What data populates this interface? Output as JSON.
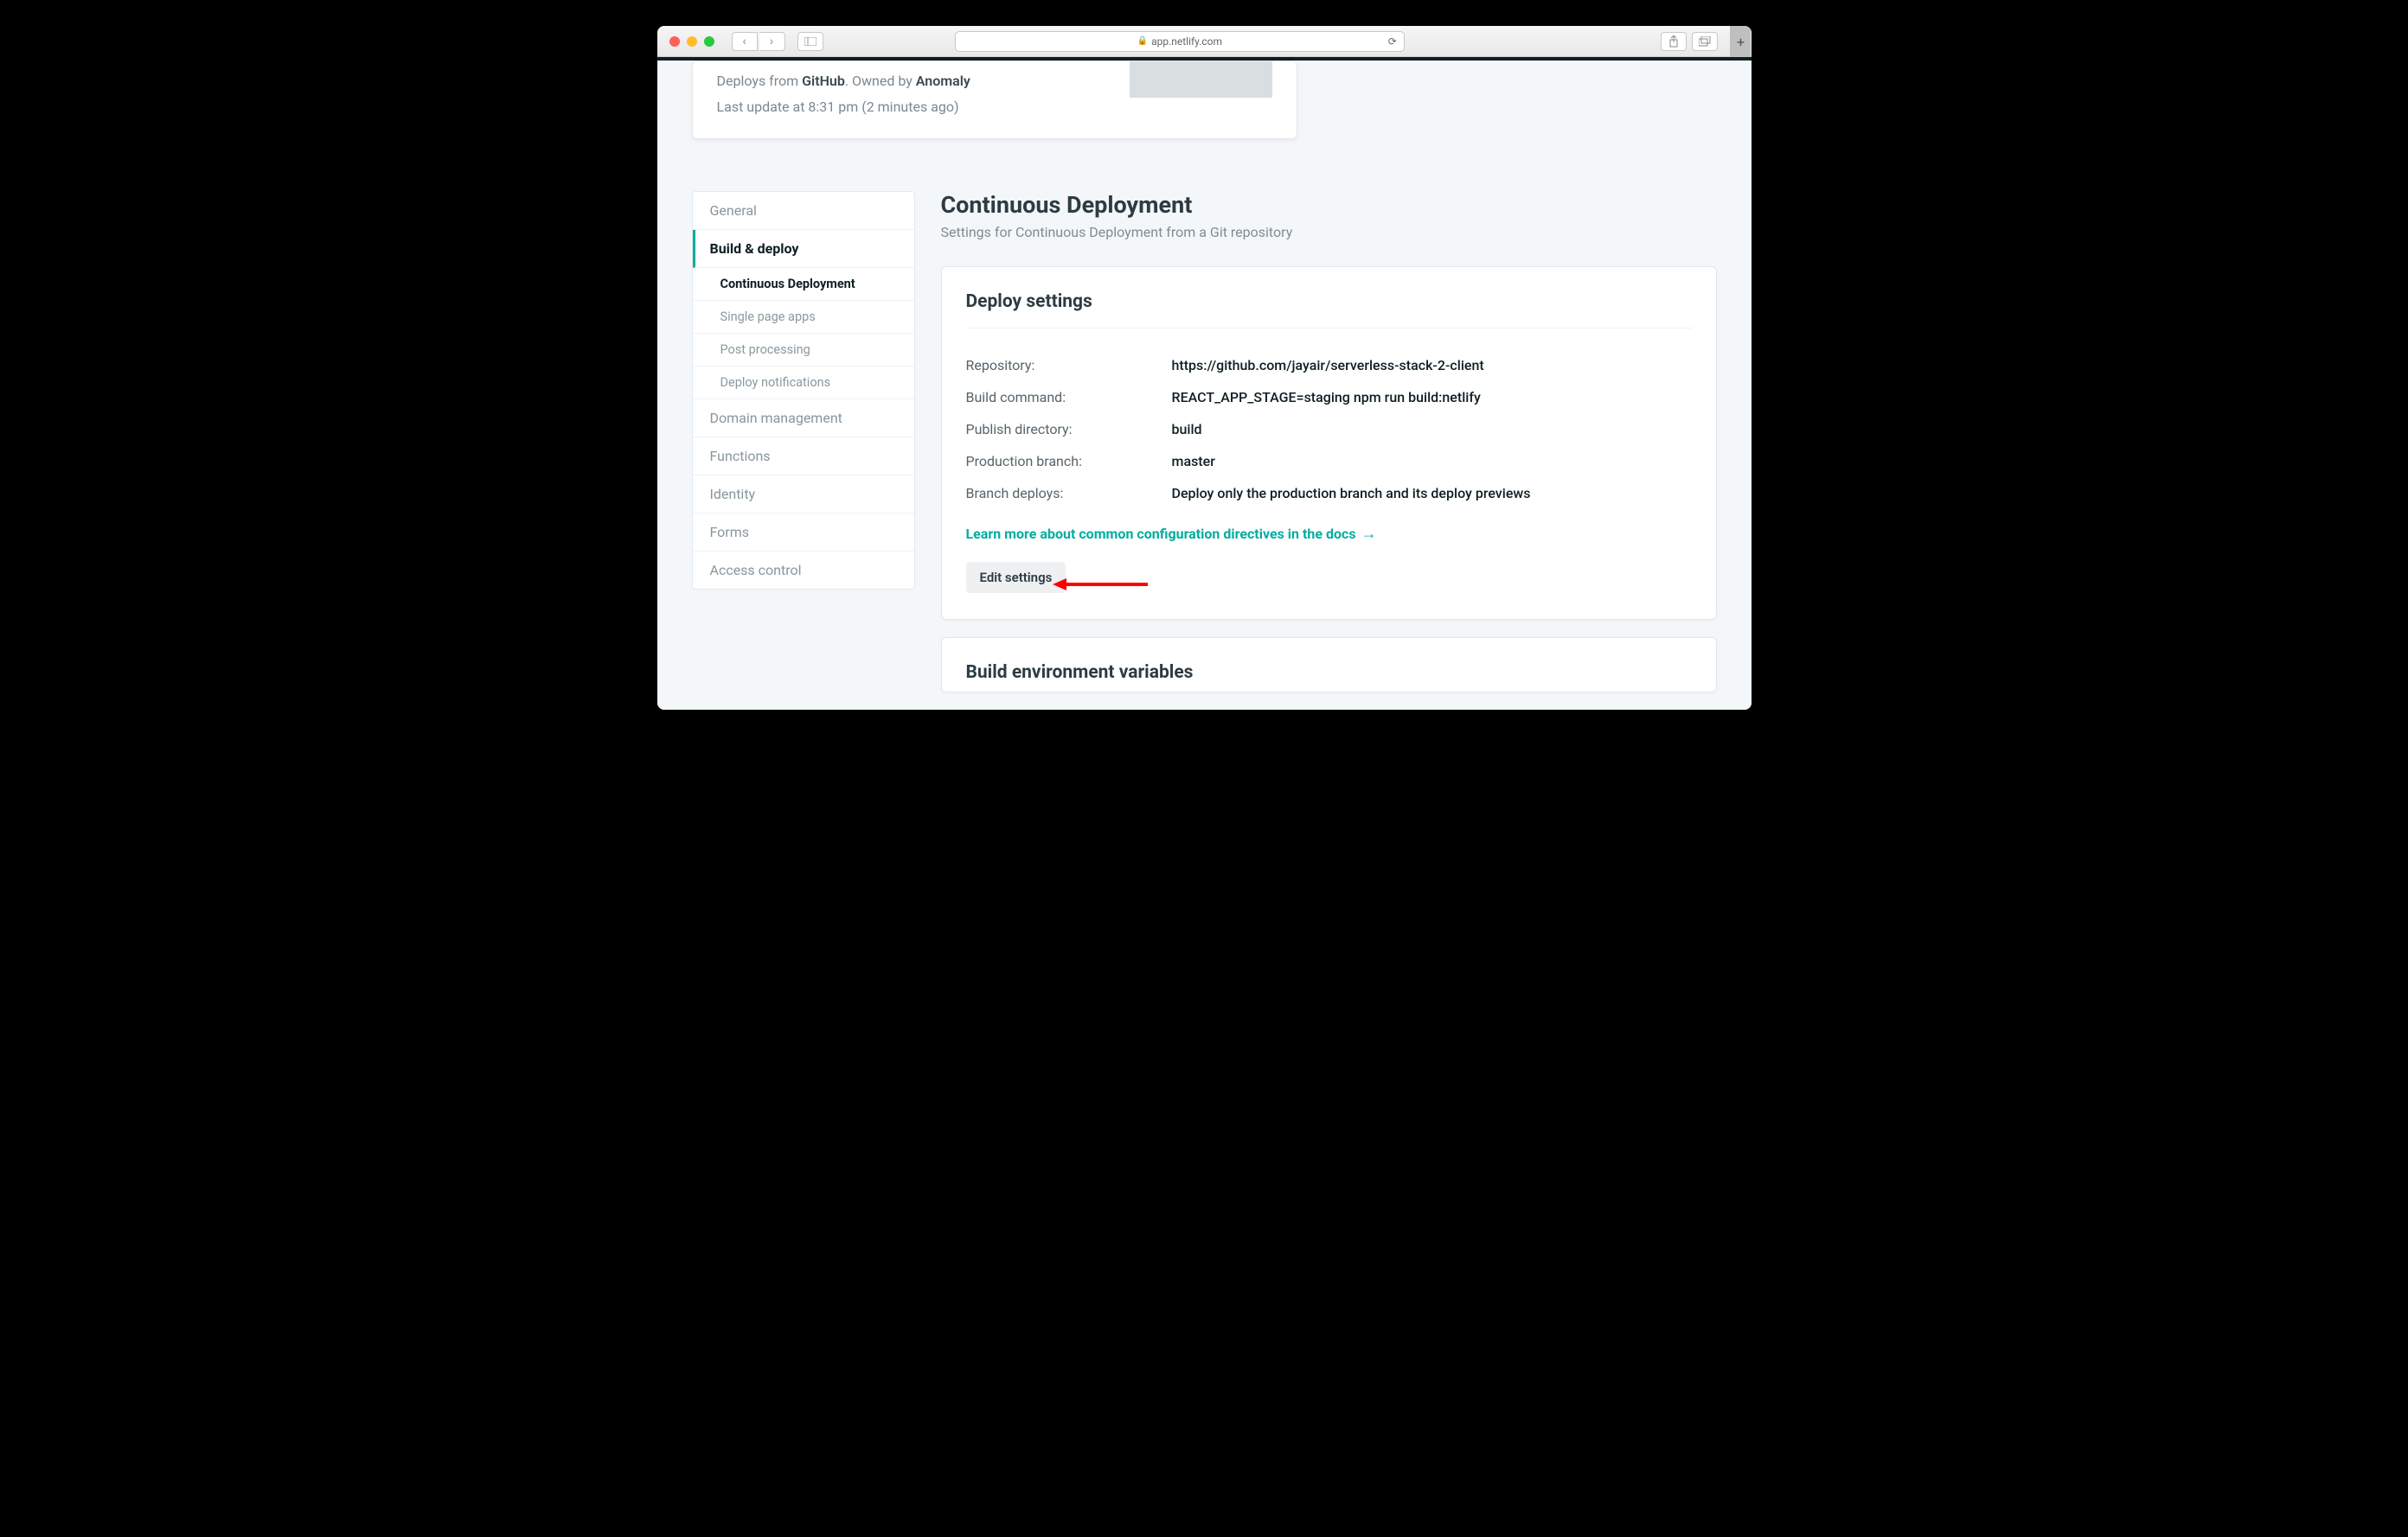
{
  "browser": {
    "url": "app.netlify.com"
  },
  "topcard": {
    "line1_prefix": "Deploys from ",
    "line1_source": "GitHub",
    "line1_mid": ". Owned by ",
    "line1_owner": "Anomaly",
    "line2": "Last update at 8:31 pm (2 minutes ago)"
  },
  "sidebar": {
    "general": "General",
    "build_deploy": "Build & deploy",
    "sub_cd": "Continuous Deployment",
    "sub_spa": "Single page apps",
    "sub_post": "Post processing",
    "sub_notif": "Deploy notifications",
    "domain": "Domain management",
    "functions": "Functions",
    "identity": "Identity",
    "forms": "Forms",
    "access": "Access control"
  },
  "page": {
    "title": "Continuous Deployment",
    "subtitle": "Settings for Continuous Deployment from a Git repository"
  },
  "deploy_card": {
    "heading": "Deploy settings",
    "rows": {
      "repo_label": "Repository:",
      "repo_val": "https://github.com/jayair/serverless-stack-2-client",
      "build_label": "Build command:",
      "build_val": "REACT_APP_STAGE=staging npm run build:netlify",
      "pub_label": "Publish directory:",
      "pub_val": "build",
      "prod_label": "Production branch:",
      "prod_val": "master",
      "branch_label": "Branch deploys:",
      "branch_val": "Deploy only the production branch and its deploy previews"
    },
    "learn": "Learn more about common configuration directives in the docs",
    "edit": "Edit settings"
  },
  "env_card": {
    "heading": "Build environment variables"
  }
}
